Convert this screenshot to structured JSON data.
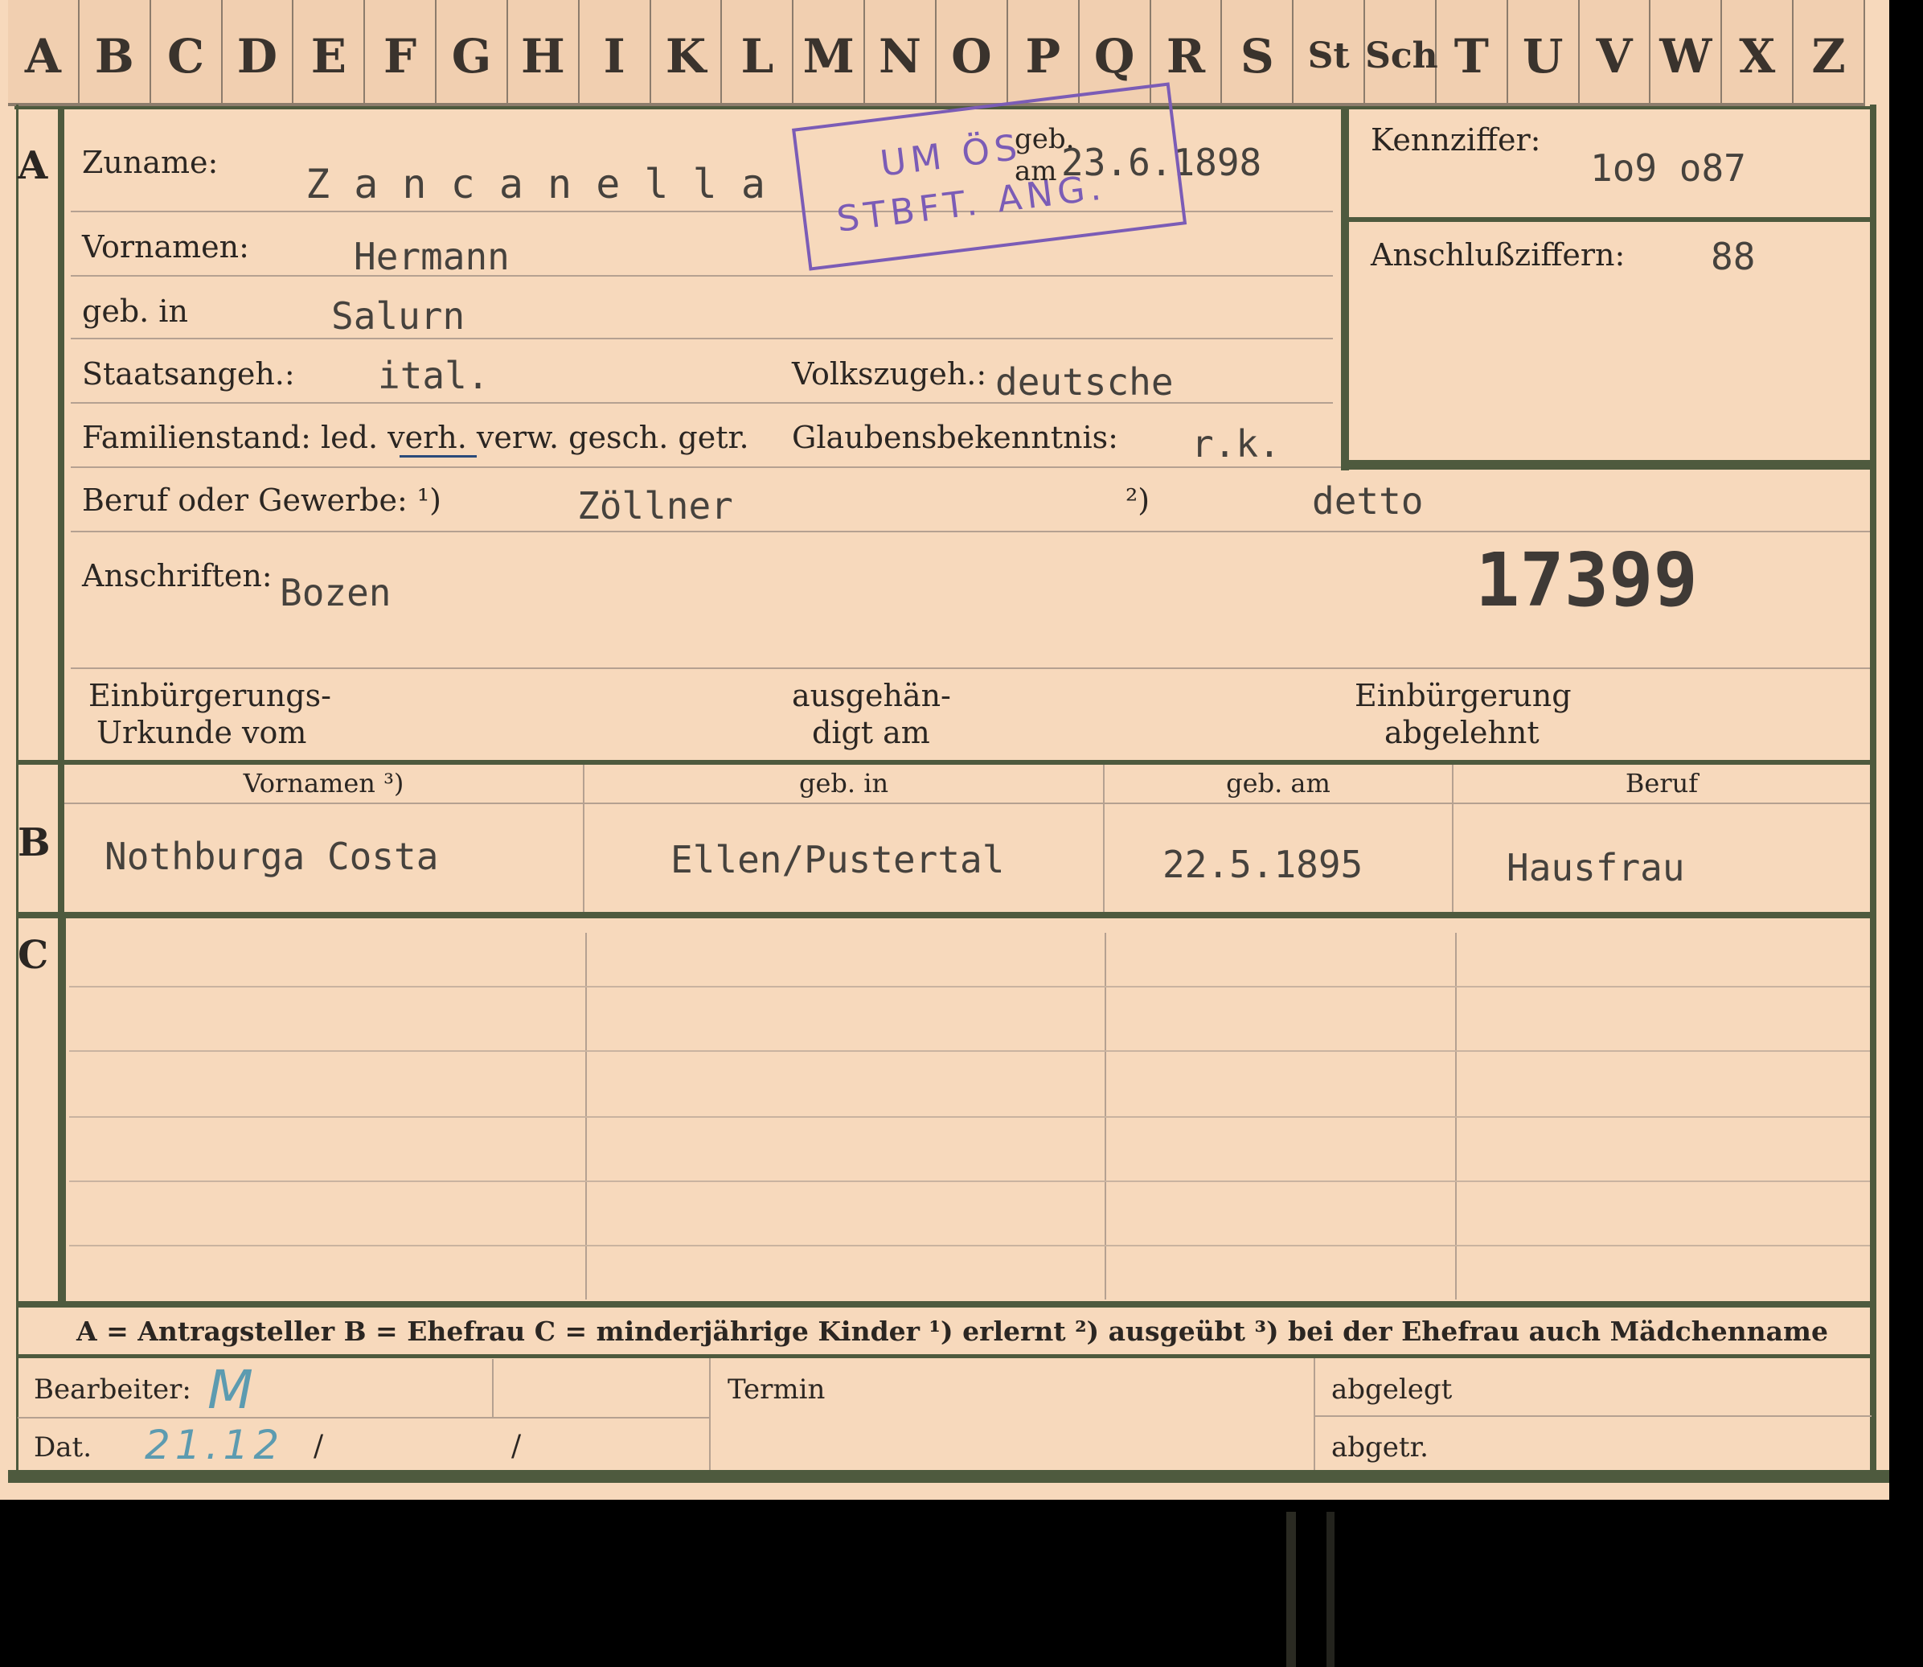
{
  "index_tabs": [
    "A",
    "B",
    "C",
    "D",
    "E",
    "F",
    "G",
    "H",
    "I",
    "K",
    "L",
    "M",
    "N",
    "O",
    "P",
    "Q",
    "R",
    "S",
    "St",
    "Sch",
    "T",
    "U",
    "V",
    "W",
    "X",
    "Z"
  ],
  "section_letters": {
    "a": "A",
    "b": "B",
    "c": "C"
  },
  "labels": {
    "zuname": "Zuname:",
    "vornamen": "Vornamen:",
    "geb_in": "geb. in",
    "staatsangeh": "Staatsangeh.:",
    "volkszugeh": "Volkszugeh.:",
    "familienstand": "Familienstand: led. verh. verw. gesch. getr.",
    "glaubensbekenntnis": "Glaubensbekenntnis:",
    "beruf": "Beruf oder Gewerbe: ¹)",
    "beruf_2": "²)",
    "anschriften": "Anschriften:",
    "einbuergerungs_1": "Einbürgerungs-",
    "einbuergerungs_2": "Urkunde vom",
    "ausgehaen_1": "ausgehän-",
    "ausgehaen_2": "digt am",
    "abgelehnt_1": "Einbürgerung",
    "abgelehnt_2": "abgelehnt",
    "kennziffer": "Kennziffer:",
    "anschlussziffern": "Anschlußziffern:",
    "geb_am_stamp": "geb.",
    "am_stamp": "am",
    "col_vornamen": "Vornamen ³)",
    "col_geb_in": "geb. in",
    "col_geb_am": "geb. am",
    "col_beruf": "Beruf",
    "legend": "A = Antragsteller   B = Ehefrau   C = minderjährige Kinder   ¹) erlernt   ²) ausgeübt   ³) bei der Ehefrau auch Mädchenname",
    "bearbeiter": "Bearbeiter:",
    "dat": "Dat.",
    "termin": "Termin",
    "abgelegt": "abgelegt",
    "abgetr": "abgetr."
  },
  "values": {
    "zuname": "Z a n c a n e l l a",
    "geb_datum": "23.6.1898",
    "vornamen": "Hermann",
    "geb_in": "Salurn",
    "staatsangeh": "ital.",
    "volkszugeh": "deutsche",
    "glaubensbekenntnis": "r.k.",
    "beruf_erlernt": "Zöllner",
    "beruf_ausgeuebt": "detto",
    "anschriften": "Bozen",
    "file_number": "17399",
    "kennziffer": "1o9 o87",
    "anschlussziffern": "88"
  },
  "stamp": {
    "line1": "UM ÖS",
    "line2": "STBFT. ANG.",
    "color": "#7b5cb6"
  },
  "ehefrau": {
    "vornamen": "Nothburga Costa",
    "geb_in": "Ellen/Pustertal",
    "geb_am": "22.5.1895",
    "beruf": "Hausfrau"
  },
  "handwritten": {
    "bearbeiter": "M",
    "dat": "21.12",
    "slash1": "/",
    "slash2": "/"
  },
  "colors": {
    "card": "#f7d9bc",
    "border": "#4e5a3e",
    "stamp": "#7b5cb6",
    "ink": "#5c9bb0"
  }
}
